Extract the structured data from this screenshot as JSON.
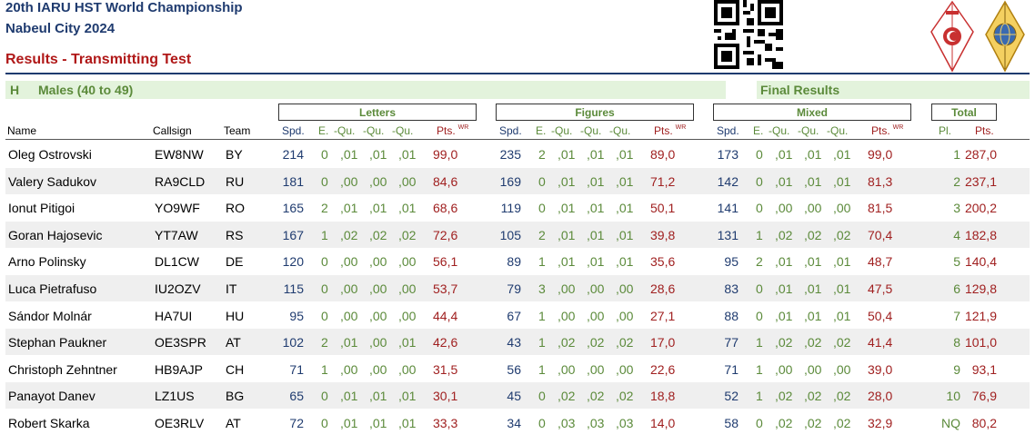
{
  "header": {
    "line1": "20th IARU HST World Championship",
    "line2": "Nabeul City 2024",
    "line3": "Results - Transmitting Test"
  },
  "category": {
    "code": "H",
    "label": "Males (40 to 49)",
    "final": "Final Results"
  },
  "groups": {
    "letters": "Letters",
    "figures": "Figures",
    "mixed": "Mixed",
    "total": "Total"
  },
  "columns": {
    "name": "Name",
    "callsign": "Callsign",
    "team": "Team",
    "spd": "Spd.",
    "e": "E.",
    "qu": "-Qu.",
    "pts": "Pts.",
    "wr": "WR",
    "pl": "Pl."
  },
  "colors": {
    "title": "#1f3b6f",
    "red": "#b01818",
    "green": "#5b8a3a",
    "band": "#e3f3dc"
  },
  "rows": [
    {
      "name": "Oleg Ostrovski",
      "call": "EW8NW",
      "team": "BY",
      "l": [
        "214",
        "0",
        ",01",
        ",01",
        ",01",
        "99,0"
      ],
      "f": [
        "235",
        "2",
        ",01",
        ",01",
        ",01",
        "89,0"
      ],
      "m": [
        "173",
        "0",
        ",01",
        ",01",
        ",01",
        "99,0"
      ],
      "pl": "1",
      "pts": "287,0"
    },
    {
      "name": "Valery Sadukov",
      "call": "RA9CLD",
      "team": "RU",
      "l": [
        "181",
        "0",
        ",00",
        ",00",
        ",00",
        "84,6"
      ],
      "f": [
        "169",
        "0",
        ",01",
        ",01",
        ",01",
        "71,2"
      ],
      "m": [
        "142",
        "0",
        ",01",
        ",01",
        ",01",
        "81,3"
      ],
      "pl": "2",
      "pts": "237,1"
    },
    {
      "name": "Ionut Pitigoi",
      "call": "YO9WF",
      "team": "RO",
      "l": [
        "165",
        "2",
        ",01",
        ",01",
        ",01",
        "68,6"
      ],
      "f": [
        "119",
        "0",
        ",01",
        ",01",
        ",01",
        "50,1"
      ],
      "m": [
        "141",
        "0",
        ",00",
        ",00",
        ",00",
        "81,5"
      ],
      "pl": "3",
      "pts": "200,2"
    },
    {
      "name": "Goran Hajosevic",
      "call": "YT7AW",
      "team": "RS",
      "l": [
        "167",
        "1",
        ",02",
        ",02",
        ",02",
        "72,6"
      ],
      "f": [
        "105",
        "2",
        ",01",
        ",01",
        ",01",
        "39,8"
      ],
      "m": [
        "131",
        "1",
        ",02",
        ",02",
        ",02",
        "70,4"
      ],
      "pl": "4",
      "pts": "182,8"
    },
    {
      "name": "Arno Polinsky",
      "call": "DL1CW",
      "team": "DE",
      "l": [
        "120",
        "0",
        ",00",
        ",00",
        ",00",
        "56,1"
      ],
      "f": [
        "89",
        "1",
        ",01",
        ",01",
        ",01",
        "35,6"
      ],
      "m": [
        "95",
        "2",
        ",01",
        ",01",
        ",01",
        "48,7"
      ],
      "pl": "5",
      "pts": "140,4"
    },
    {
      "name": "Luca Pietrafuso",
      "call": "IU2OZV",
      "team": "IT",
      "l": [
        "115",
        "0",
        ",00",
        ",00",
        ",00",
        "53,7"
      ],
      "f": [
        "79",
        "3",
        ",00",
        ",00",
        ",00",
        "28,6"
      ],
      "m": [
        "83",
        "0",
        ",01",
        ",01",
        ",01",
        "47,5"
      ],
      "pl": "6",
      "pts": "129,8"
    },
    {
      "name": "Sándor Molnár",
      "call": "HA7UI",
      "team": "HU",
      "l": [
        "95",
        "0",
        ",00",
        ",00",
        ",00",
        "44,4"
      ],
      "f": [
        "67",
        "1",
        ",00",
        ",00",
        ",00",
        "27,1"
      ],
      "m": [
        "88",
        "0",
        ",01",
        ",01",
        ",01",
        "50,4"
      ],
      "pl": "7",
      "pts": "121,9"
    },
    {
      "name": "Stephan Paukner",
      "call": "OE3SPR",
      "team": "AT",
      "l": [
        "102",
        "2",
        ",01",
        ",00",
        ",01",
        "42,6"
      ],
      "f": [
        "43",
        "1",
        ",02",
        ",02",
        ",02",
        "17,0"
      ],
      "m": [
        "77",
        "1",
        ",02",
        ",02",
        ",02",
        "41,4"
      ],
      "pl": "8",
      "pts": "101,0"
    },
    {
      "name": "Christoph Zehntner",
      "call": "HB9AJP",
      "team": "CH",
      "l": [
        "71",
        "1",
        ",00",
        ",00",
        ",00",
        "31,5"
      ],
      "f": [
        "56",
        "1",
        ",00",
        ",00",
        ",00",
        "22,6"
      ],
      "m": [
        "71",
        "1",
        ",00",
        ",00",
        ",00",
        "39,0"
      ],
      "pl": "9",
      "pts": "93,1"
    },
    {
      "name": "Panayot Danev",
      "call": "LZ1US",
      "team": "BG",
      "l": [
        "65",
        "0",
        ",01",
        ",01",
        ",01",
        "30,1"
      ],
      "f": [
        "45",
        "0",
        ",02",
        ",02",
        ",02",
        "18,8"
      ],
      "m": [
        "52",
        "1",
        ",02",
        ",02",
        ",02",
        "28,0"
      ],
      "pl": "10",
      "pts": "76,9"
    },
    {
      "name": "Robert Skarka",
      "call": "OE3RLV",
      "team": "AT",
      "l": [
        "72",
        "0",
        ",01",
        ",01",
        ",01",
        "33,3"
      ],
      "f": [
        "34",
        "0",
        ",03",
        ",03",
        ",03",
        "14,0"
      ],
      "m": [
        "58",
        "0",
        ",02",
        ",02",
        ",02",
        "32,9"
      ],
      "pl": "NQ",
      "pts": "80,2"
    }
  ]
}
